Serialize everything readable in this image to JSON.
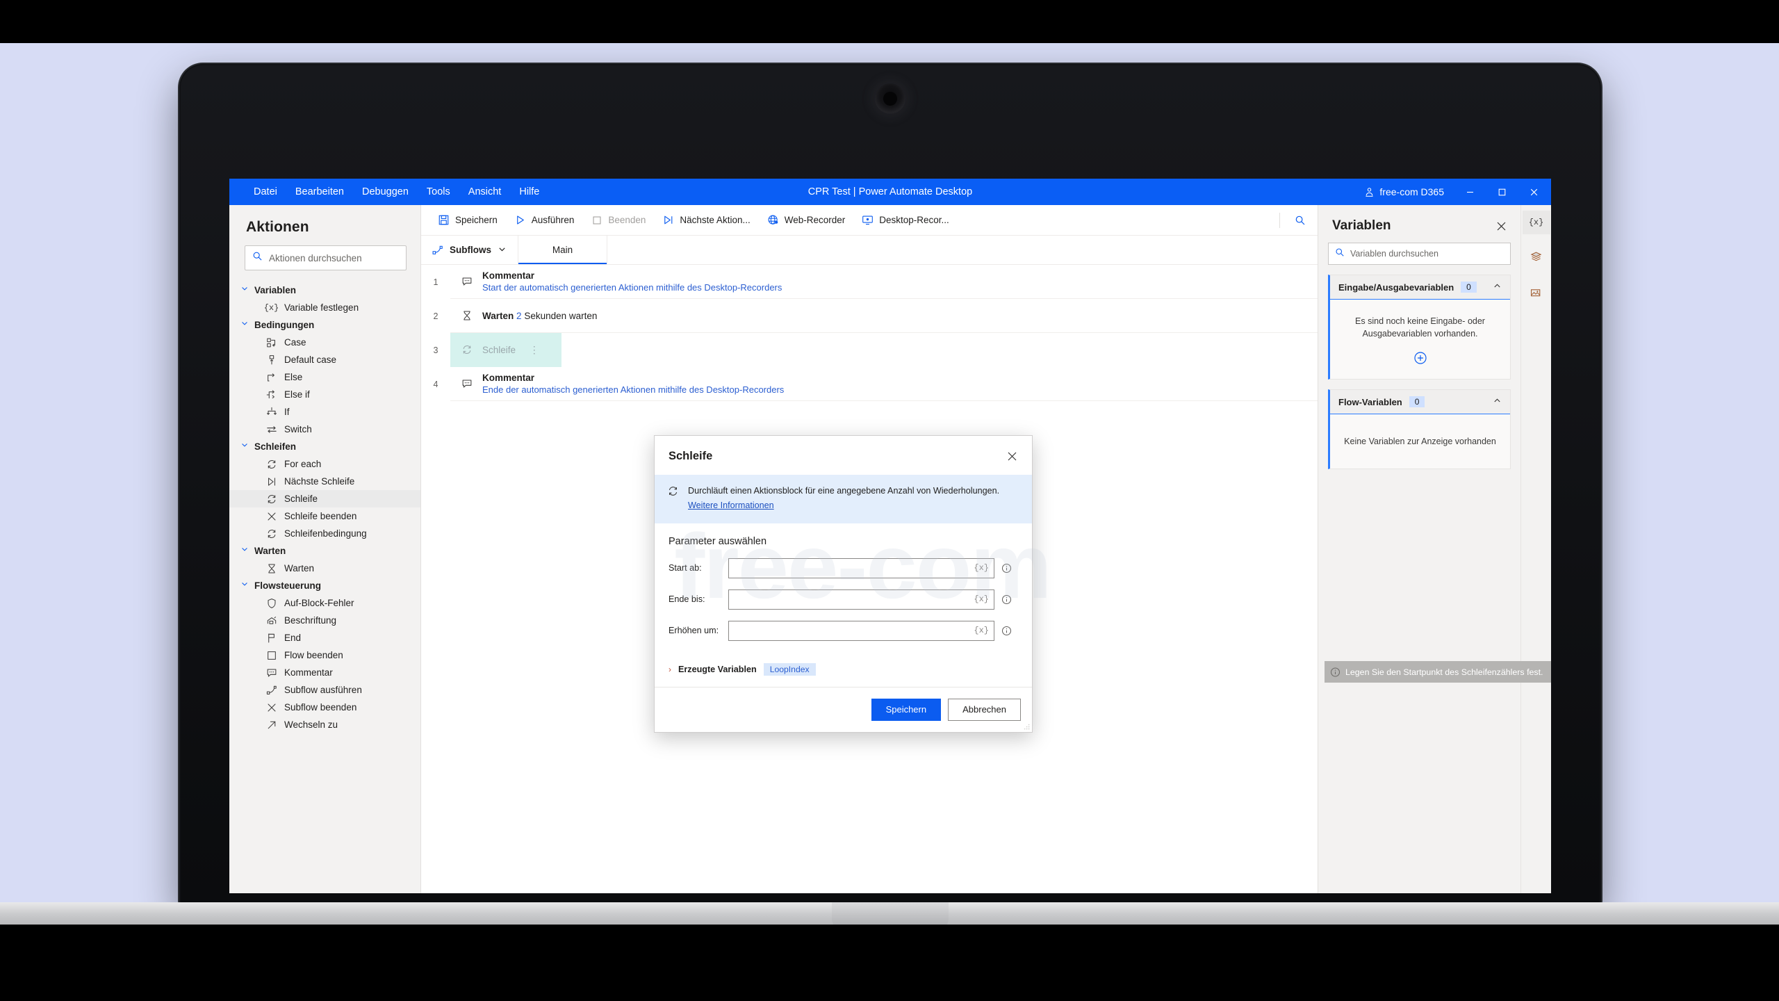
{
  "titlebar": {
    "menus": [
      "Datei",
      "Bearbeiten",
      "Debuggen",
      "Tools",
      "Ansicht",
      "Hilfe"
    ],
    "app_title": "CPR Test | Power Automate Desktop",
    "account": "free-com D365",
    "minimize": "–",
    "maximize": "☐",
    "close": "✕"
  },
  "left_panel": {
    "title": "Aktionen",
    "search_placeholder": "Aktionen durchsuchen",
    "search_value": "",
    "groups": [
      {
        "label": "Variablen",
        "items": [
          {
            "label": "Variable festlegen",
            "icon": "braces-x-icon",
            "selected": false
          }
        ]
      },
      {
        "label": "Bedingungen",
        "items": [
          {
            "label": "Case",
            "icon": "case-icon",
            "selected": false
          },
          {
            "label": "Default case",
            "icon": "default-case-icon",
            "selected": false
          },
          {
            "label": "Else",
            "icon": "else-icon",
            "selected": false
          },
          {
            "label": "Else if",
            "icon": "else-if-icon",
            "selected": false
          },
          {
            "label": "If",
            "icon": "if-icon",
            "selected": false
          },
          {
            "label": "Switch",
            "icon": "switch-icon",
            "selected": false
          }
        ]
      },
      {
        "label": "Schleifen",
        "items": [
          {
            "label": "For each",
            "icon": "loop-icon",
            "selected": false
          },
          {
            "label": "Nächste Schleife",
            "icon": "next-loop-icon",
            "selected": false
          },
          {
            "label": "Schleife",
            "icon": "loop-icon",
            "selected": true
          },
          {
            "label": "Schleife beenden",
            "icon": "close-x-icon",
            "selected": false
          },
          {
            "label": "Schleifenbedingung",
            "icon": "loop-icon",
            "selected": false
          }
        ]
      },
      {
        "label": "Warten",
        "items": [
          {
            "label": "Warten",
            "icon": "hourglass-icon",
            "selected": false
          }
        ]
      },
      {
        "label": "Flowsteuerung",
        "items": [
          {
            "label": "Auf-Block-Fehler",
            "icon": "shield-icon",
            "selected": false
          },
          {
            "label": "Beschriftung",
            "icon": "label-icon",
            "selected": false
          },
          {
            "label": "End",
            "icon": "flag-icon",
            "selected": false
          },
          {
            "label": "Flow beenden",
            "icon": "square-icon",
            "selected": false
          },
          {
            "label": "Kommentar",
            "icon": "comment-icon",
            "selected": false
          },
          {
            "label": "Subflow ausführen",
            "icon": "subflow-icon",
            "selected": false
          },
          {
            "label": "Subflow beenden",
            "icon": "close-x-icon",
            "selected": false
          },
          {
            "label": "Wechseln zu",
            "icon": "arrow-up-right-icon",
            "selected": false
          }
        ]
      }
    ]
  },
  "toolbar": {
    "buttons": [
      {
        "label": "Speichern",
        "icon": "save-icon",
        "disabled": false
      },
      {
        "label": "Ausführen",
        "icon": "play-icon",
        "disabled": false
      },
      {
        "label": "Beenden",
        "icon": "stop-icon",
        "disabled": true
      },
      {
        "label": "Nächste Aktion...",
        "icon": "step-icon",
        "disabled": false
      },
      {
        "label": "Web-Recorder",
        "icon": "globe-icon",
        "disabled": false
      },
      {
        "label": "Desktop-Recor...",
        "icon": "monitor-icon",
        "disabled": false
      }
    ],
    "search_icon": "search-icon"
  },
  "subbar": {
    "subflows_label": "Subflows",
    "tabs": [
      {
        "label": "Main",
        "active": true
      }
    ]
  },
  "flow_rows": [
    {
      "number": "1",
      "icon": "comment-icon",
      "title": "Kommentar",
      "subtitle": "Start der automatisch generierten Aktionen mithilfe des Desktop-Recorders",
      "selected": false
    },
    {
      "number": "2",
      "icon": "hourglass-icon",
      "title": "Warten",
      "inline_value": "2",
      "inline_rest": "Sekunden warten",
      "selected": false
    },
    {
      "number": "3",
      "icon": "loop-icon",
      "title": "Schleife",
      "menu_dots": "⋮",
      "selected": true
    },
    {
      "number": "4",
      "icon": "comment-icon",
      "title": "Kommentar",
      "subtitle": "Ende der automatisch generierten Aktionen mithilfe des Desktop-Recorders",
      "selected": false
    }
  ],
  "right_panel": {
    "title": "Variablen",
    "close_icon": "close-icon",
    "search_placeholder": "Variablen durchsuchen",
    "search_value": "",
    "sections": [
      {
        "title": "Eingabe/Ausgabevariablen",
        "count": "0",
        "empty_text": "Es sind noch keine Eingabe- oder Ausgabevariablen vorhanden.",
        "add_icon": "plus-circle-icon",
        "has_add": true,
        "collapse_icon": "chevron-up-icon"
      },
      {
        "title": "Flow-Variablen",
        "count": "0",
        "empty_text": "Keine Variablen zur Anzeige vorhanden",
        "has_add": false,
        "collapse_icon": "chevron-up-icon"
      }
    ]
  },
  "rail": [
    {
      "icon": "braces-x-icon",
      "label": "{x}",
      "active": true
    },
    {
      "icon": "layers-icon",
      "label": "",
      "active": false
    },
    {
      "icon": "image-icon",
      "label": "",
      "active": false
    }
  ],
  "modal": {
    "title": "Schleife",
    "close_icon": "close-icon",
    "description": "Durchläuft einen Aktionsblock für eine angegebene Anzahl von Wiederholungen.",
    "description_icon": "loop-icon",
    "link": "Weitere Informationen",
    "section_title": "Parameter auswählen",
    "fields": [
      {
        "label": "Start ab:",
        "value": "",
        "var_token": "{x}",
        "info_icon": "info-icon"
      },
      {
        "label": "Ende bis:",
        "value": "",
        "var_token": "{x}",
        "info_icon": "info-icon"
      },
      {
        "label": "Erhöhen um:",
        "value": "",
        "var_token": "{x}",
        "info_icon": "info-icon"
      }
    ],
    "produced_vars_label": "Erzeugte Variablen",
    "produced_vars_chevron": "›",
    "produced_vars": [
      "LoopIndex"
    ],
    "save_label": "Speichern",
    "cancel_label": "Abbrechen"
  },
  "tooltip": {
    "text": "Legen Sie den Startpunkt des Schleifenzählers fest.",
    "icon": "info-icon"
  },
  "watermark": {
    "text": "free-com"
  },
  "colors": {
    "accent": "#0a5ef5",
    "link": "#2c5fd1",
    "selection": "#d6f2ee",
    "panel_bg": "#f3f2f1",
    "info_bg": "#e3eefc",
    "page_bg": "#d7dcf5"
  }
}
